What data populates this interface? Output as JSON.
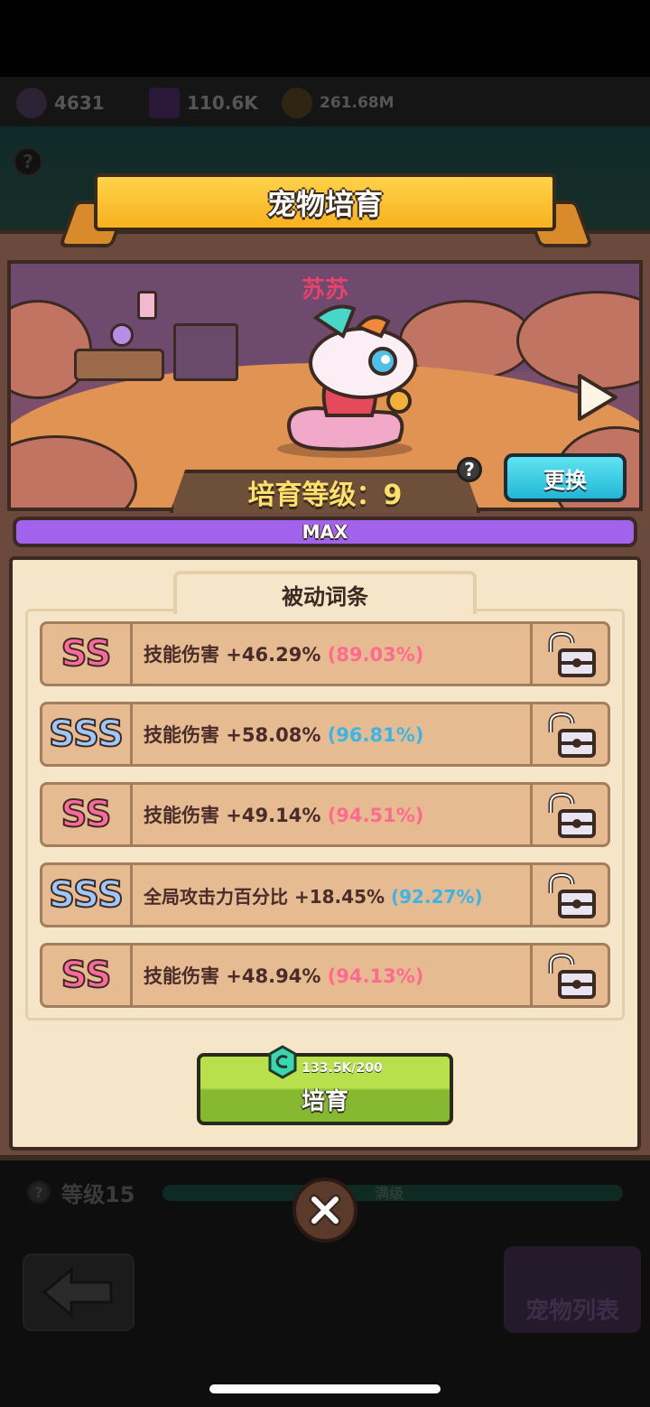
{
  "resources": [
    {
      "icon": "dark-egg-icon",
      "value": "4631"
    },
    {
      "icon": "purple-cube-icon",
      "value": "110.6K"
    },
    {
      "icon": "gold-coin-icon",
      "value": "261.68M"
    }
  ],
  "panel": {
    "title": "宠物培育"
  },
  "pet": {
    "name": "苏苏",
    "level_label": "培育等级：9",
    "swap_label": "更换",
    "progress_label": "MAX",
    "progress": 1.0
  },
  "passive": {
    "tab_label": "被动词条",
    "rows": [
      {
        "grade": "SS",
        "grade_type": "ss",
        "text": "技能伤害 +46.29%",
        "pct": "(89.03%)",
        "pct_color": "pink"
      },
      {
        "grade": "SSS",
        "grade_type": "sss",
        "text": "技能伤害 +58.08%",
        "pct": "(96.81%)",
        "pct_color": "blue"
      },
      {
        "grade": "SS",
        "grade_type": "ss",
        "text": "技能伤害 +49.14%",
        "pct": "(94.51%)",
        "pct_color": "pink"
      },
      {
        "grade": "SSS",
        "grade_type": "sss",
        "text": "全局攻击力百分比 +18.45%",
        "pct": "(92.27%)",
        "pct_color": "blue"
      },
      {
        "grade": "SS",
        "grade_type": "ss",
        "text": "技能伤害 +48.94%",
        "pct": "(94.13%)",
        "pct_color": "pink"
      }
    ]
  },
  "cultivate": {
    "label": "培育",
    "cost": "133.5K/200",
    "cost_icon": "green-gem-icon"
  },
  "background": {
    "level_label": "等级15",
    "max_label": "满级",
    "pet_list_label": "宠物列表"
  },
  "colors": {
    "ss": "#ff6a9e",
    "sss": "#9cc7ff",
    "pct_pink": "#ff6a8e",
    "pct_blue": "#39b6e6",
    "swap_button": "#3ccbe4",
    "cultivate_button": "#a6d43e",
    "progress": "#a262ec"
  }
}
